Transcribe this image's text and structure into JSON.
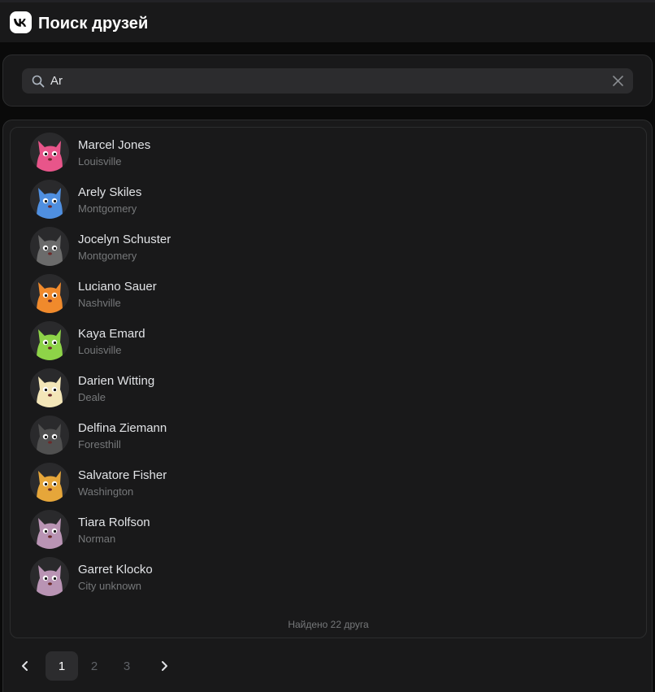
{
  "header": {
    "title": "Поиск друзей"
  },
  "search": {
    "value": "Ar"
  },
  "friends": [
    {
      "name": "Marcel Jones",
      "city": "Louisville",
      "color": "#e8558a"
    },
    {
      "name": "Arely Skiles",
      "city": "Montgomery",
      "color": "#4f8fe0"
    },
    {
      "name": "Jocelyn Schuster",
      "city": "Montgomery",
      "color": "#6b6b6b"
    },
    {
      "name": "Luciano Sauer",
      "city": "Nashville",
      "color": "#f08a2c"
    },
    {
      "name": "Kaya Emard",
      "city": "Louisville",
      "color": "#8ed448"
    },
    {
      "name": "Darien Witting",
      "city": "Deale",
      "color": "#f3e6b8"
    },
    {
      "name": "Delfina Ziemann",
      "city": "Foresthill",
      "color": "#505050"
    },
    {
      "name": "Salvatore Fisher",
      "city": "Washington",
      "color": "#e6a63a"
    },
    {
      "name": "Tiara Rolfson",
      "city": "Norman",
      "color": "#b994b4"
    },
    {
      "name": "Garret Klocko",
      "city": "City unknown",
      "color": "#b994b4"
    }
  ],
  "found_text": "Найдено 22 друга",
  "pagination": {
    "pages": [
      "1",
      "2",
      "3"
    ],
    "current": "1"
  }
}
